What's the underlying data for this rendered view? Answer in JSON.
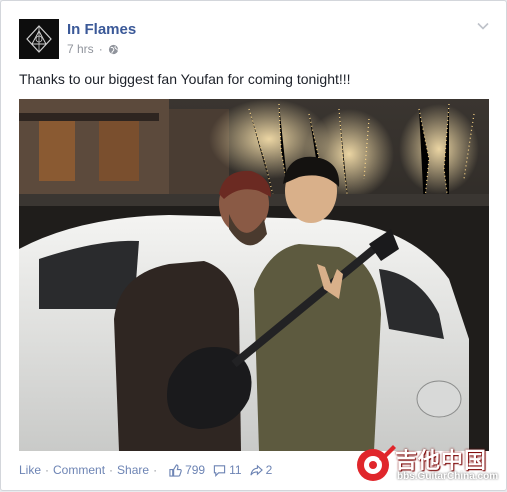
{
  "post": {
    "page_name": "In Flames",
    "time": "7 hrs",
    "privacy_icon": "globe-icon",
    "options_icon": "chevron-down-icon",
    "text": "Thanks to our biggest fan Youfan for coming tonight!!!"
  },
  "actions": {
    "like": "Like",
    "comment": "Comment",
    "share": "Share",
    "separator": "·",
    "likes_count": "799",
    "comments_count": "11",
    "shares_count": "2"
  },
  "watermark": {
    "title": "吉他中国",
    "url": "bbs.GuitarChina.com"
  },
  "colors": {
    "link": "#3b5998",
    "action_link": "#6d84b4",
    "meta": "#90949c",
    "watermark_red": "#e0262b"
  }
}
